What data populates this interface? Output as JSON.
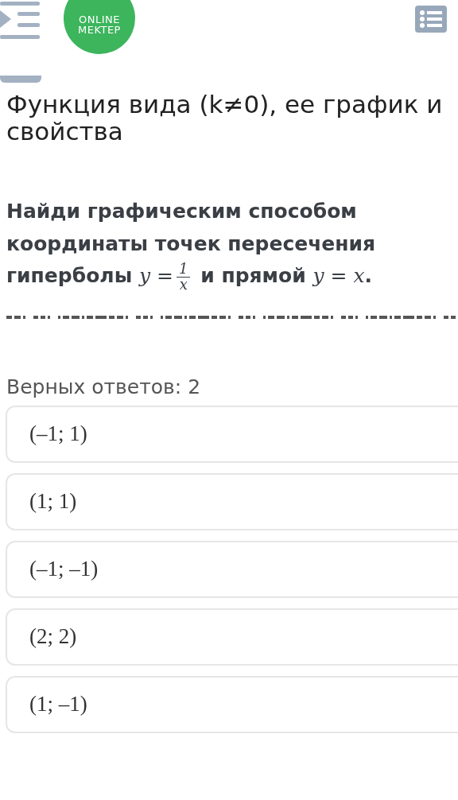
{
  "header": {
    "logo": {
      "line1": "ONLINE",
      "line2": "MEKTEP"
    }
  },
  "title": "Функция вида (k≠0), ее график и свойства",
  "question": {
    "parts": [
      {
        "kind": "text",
        "text": "Найди графическим способом координаты точек пересечения гиперболы "
      },
      {
        "kind": "math",
        "text": "y ="
      },
      {
        "kind": "fraction",
        "numerator": "1",
        "denominator": "x"
      },
      {
        "kind": "text",
        "text": " и прямой "
      },
      {
        "kind": "math",
        "text": "y = x"
      },
      {
        "kind": "text",
        "text": "."
      }
    ]
  },
  "answers_count": "Верных ответов: 2",
  "answers": [
    {
      "text": "(–1; 1)"
    },
    {
      "text": "(1; 1)"
    },
    {
      "text": "(–1; –1)"
    },
    {
      "text": "(2; 2)"
    },
    {
      "text": "(1; –1)"
    }
  ]
}
